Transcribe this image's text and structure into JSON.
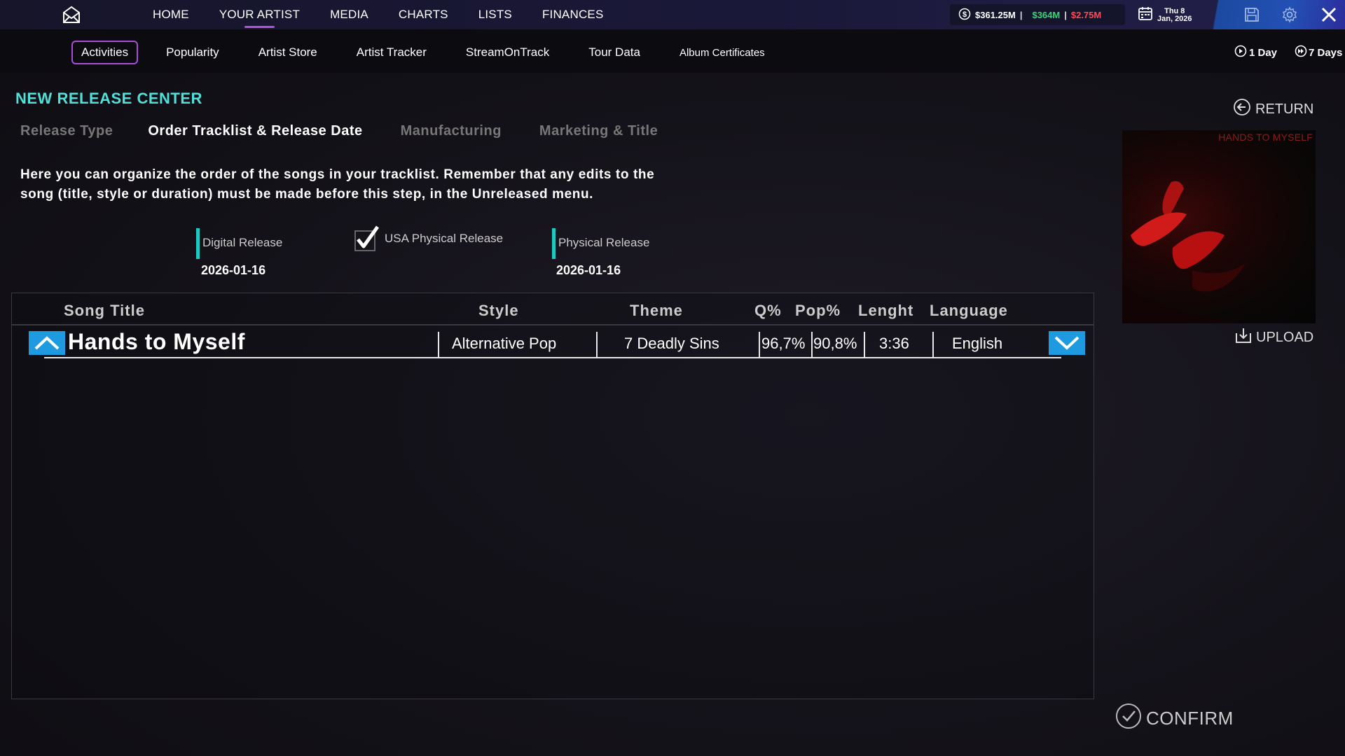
{
  "topbar": {
    "nav": [
      {
        "label": "HOME"
      },
      {
        "label": "YOUR ARTIST",
        "active": true
      },
      {
        "label": "MEDIA"
      },
      {
        "label": "CHARTS"
      },
      {
        "label": "LISTS"
      },
      {
        "label": "FINANCES"
      }
    ],
    "money": {
      "total": "$361.25M",
      "sep1": "|",
      "income": "$364M",
      "sep2": "|",
      "expense": "$2.75M"
    },
    "date": {
      "line1": "Thu 8",
      "line2": "Jan, 2026"
    },
    "icons": [
      "mail-icon",
      "dollar-icon",
      "calendar-icon",
      "save-icon",
      "gear-icon",
      "close-icon"
    ],
    "colors": {
      "accent_purple": "#a64fd8",
      "teal": "#4fe0da",
      "income_green": "#38d67a",
      "expense_red": "#ff4a55",
      "button_blue": "#1e9be0"
    }
  },
  "subnav": {
    "items": [
      "Activities",
      "Popularity",
      "Artist Store",
      "Artist Tracker",
      "StreamOnTrack",
      "Tour Data",
      "Album Certificates"
    ],
    "active": "Activities",
    "time_one_day": "1 Day",
    "time_seven_days": "7 Days"
  },
  "page": {
    "title": "NEW RELEASE CENTER",
    "steps": [
      "Release Type",
      "Order Tracklist & Release Date",
      "Manufacturing",
      "Marketing & Title"
    ],
    "active_step": "Order Tracklist & Release Date",
    "instructions_line1": "Here you can organize the order of the songs in your tracklist. Remember that any edits to the",
    "instructions_line2": "song (title, style or duration) must be made before this step, in the Unreleased menu.",
    "digital_release": {
      "label": "Digital Release",
      "date": "2026-01-16"
    },
    "usa_physical": {
      "label": "USA Physical Release",
      "checked": true
    },
    "physical_release": {
      "label": "Physical Release",
      "date": "2026-01-16"
    }
  },
  "table": {
    "headers": {
      "title": "Song Title",
      "style": "Style",
      "theme": "Theme",
      "q": "Q%",
      "pop": "Pop%",
      "length": "Lenght",
      "language": "Language"
    },
    "rows": [
      {
        "title": "Hands to Myself",
        "style": "Alternative Pop",
        "theme": "7 Deadly Sins",
        "q": "96,7%",
        "pop": "90,8%",
        "length": "3:36",
        "language": "English"
      }
    ]
  },
  "sidebar": {
    "return_label": "RETURN",
    "cover_text": "HANDS TO MYSELF",
    "upload_label": "UPLOAD",
    "confirm_label": "CONFIRM"
  }
}
